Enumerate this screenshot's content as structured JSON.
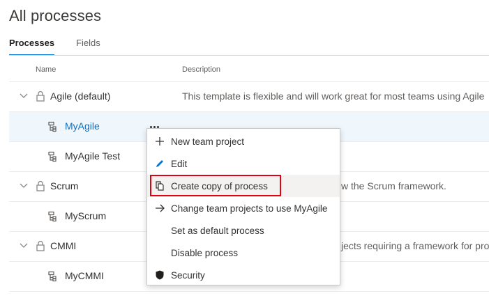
{
  "page": {
    "title": "All processes"
  },
  "tabs": [
    {
      "label": "Processes",
      "active": true
    },
    {
      "label": "Fields",
      "active": false
    }
  ],
  "table": {
    "headers": {
      "name": "Name",
      "description": "Description"
    },
    "rows": [
      {
        "name": "Agile (default)",
        "type": "parent",
        "icon": "lock-icon",
        "description": "This template is flexible and will work great for most teams using Agile"
      },
      {
        "name": "MyAgile",
        "type": "child",
        "icon": "inherited-process-icon",
        "description": "",
        "selected": true
      },
      {
        "name": "MyAgile Test",
        "type": "child",
        "icon": "inherited-process-icon",
        "description": ""
      },
      {
        "name": "Scrum",
        "type": "parent",
        "icon": "lock-icon",
        "description": "w the Scrum framework."
      },
      {
        "name": "MyScrum",
        "type": "child",
        "icon": "inherited-process-icon",
        "description": ""
      },
      {
        "name": "CMMI",
        "type": "parent",
        "icon": "lock-icon",
        "description": "jects requiring a framework for pro"
      },
      {
        "name": "MyCMMI",
        "type": "child",
        "icon": "inherited-process-icon",
        "description": ""
      }
    ]
  },
  "context_menu": {
    "items": [
      {
        "label": "New team project",
        "icon": "plus-icon"
      },
      {
        "label": "Edit",
        "icon": "pencil-icon"
      },
      {
        "label": "Create copy of process",
        "icon": "copy-icon",
        "hovered": true,
        "highlighted": true
      },
      {
        "label": "Change team projects to use MyAgile",
        "icon": "arrow-right-icon"
      },
      {
        "label": "Set as default process",
        "icon": ""
      },
      {
        "label": "Disable process",
        "icon": ""
      },
      {
        "label": "Security",
        "icon": "shield-icon"
      }
    ]
  },
  "colors": {
    "accent": "#0078d4",
    "selected_row": "#eff6fc",
    "link": "#106ebe",
    "highlight_border": "#e3000f"
  }
}
